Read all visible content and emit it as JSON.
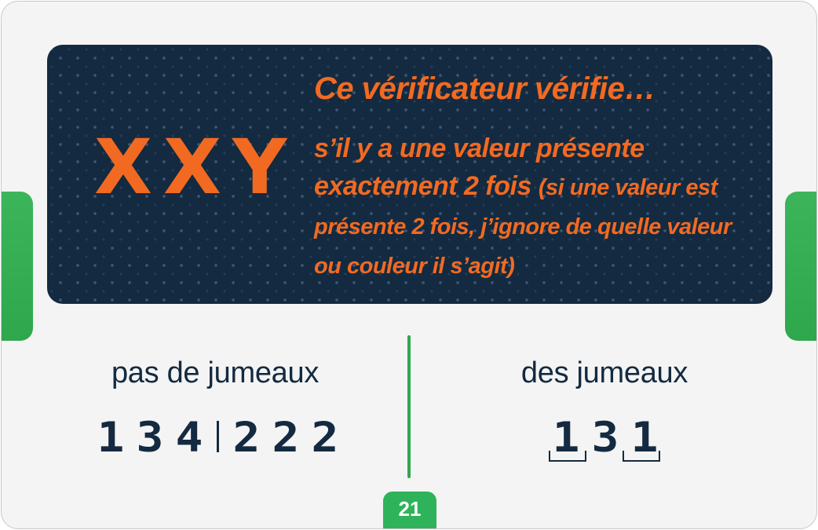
{
  "banner": {
    "code": "XXY",
    "headline": "Ce vérificateur vérifie…",
    "desc_main": "s’il y a une valeur présente exactement 2 fois",
    "desc_aside": "(si une valeur est présente 2 fois, j’ignore de quelle valeur ou couleur il s’agit)"
  },
  "examples": {
    "no_twins": {
      "title": "pas de jumeaux",
      "groups": [
        [
          "1",
          "3",
          "4"
        ],
        [
          "2",
          "2",
          "2"
        ]
      ]
    },
    "twins": {
      "title": "des jumeaux",
      "digits": [
        "1",
        "3",
        "1"
      ]
    }
  },
  "page_number": "21",
  "colors": {
    "navy": "#142a40",
    "orange": "#f26a21",
    "green": "#2fb35a",
    "background": "#f4f4f4"
  }
}
